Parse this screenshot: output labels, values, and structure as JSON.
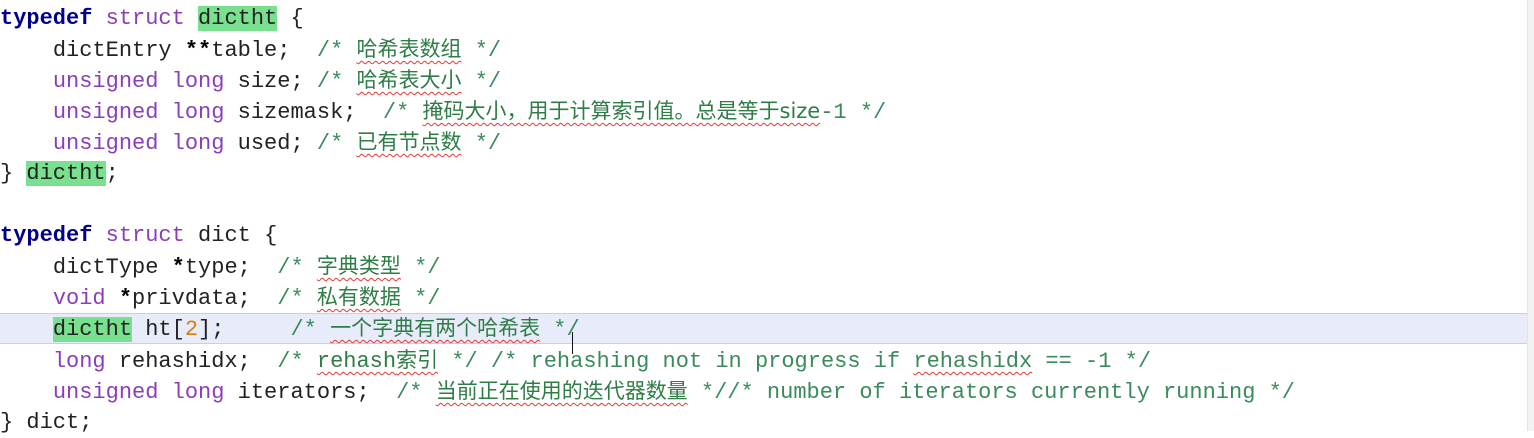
{
  "code": {
    "line1": {
      "kw": "typedef",
      "struct_kw": "struct",
      "name": "dictht",
      "brace": "{"
    },
    "line2": {
      "type": "dictEntry",
      "ptr": "**",
      "field": "table;",
      "cmt_open": "/*",
      "cmt_text": "哈希表数组",
      "cmt_close": "*/"
    },
    "line3": {
      "type": "unsigned long",
      "field": "size;",
      "cmt_open": "/*",
      "cmt_text": "哈希表大小",
      "cmt_close": "*/"
    },
    "line4": {
      "type": "unsigned long",
      "field": "sizemask;",
      "cmt_open": "/*",
      "cmt_text": "掩码大小，用于计算索引值。总是等于size",
      "cmt_tail": "-1",
      "cmt_close": "*/"
    },
    "line5": {
      "type": "unsigned long",
      "field": "used;",
      "cmt_open": "/*",
      "cmt_text": "已有节点数",
      "cmt_close": "*/"
    },
    "line6": {
      "close_brace": "}",
      "name": "dictht",
      "semi": ";"
    },
    "line8": {
      "kw": "typedef",
      "struct_kw": "struct",
      "name": "dict",
      "brace": "{"
    },
    "line9": {
      "type": "dictType",
      "ptr": "*",
      "field": "type;",
      "cmt_open": "/*",
      "cmt_text": "字典类型",
      "cmt_close": "*/"
    },
    "line10": {
      "type": "void",
      "ptr": "*",
      "field": "privdata;",
      "cmt_open": "/*",
      "cmt_text": "私有数据",
      "cmt_close": "*/"
    },
    "line11": {
      "type": "dictht",
      "field_a": "ht[",
      "num": "2",
      "field_b": "];",
      "cmt_open": "/*",
      "cmt_text": "一个字典有两个哈希表",
      "cmt_close": "*/"
    },
    "line12": {
      "type": "long",
      "field": "rehashidx;",
      "cmt_open": "/*",
      "cmt_text_a": "rehash",
      "cmt_text_b": "索引",
      "cmt_mid": "*/ /* rehashing not in progress if",
      "cmt_word": "rehashidx",
      "cmt_tail": "== -1 */"
    },
    "line13": {
      "type": "unsigned long",
      "field": "iterators;",
      "cmt_open": "/*",
      "cmt_text": "当前正在使用的迭代器数量",
      "cmt_close": "*//* number of iterators currently running */"
    },
    "line14": {
      "close_brace": "}",
      "name": "dict;"
    }
  },
  "colors": {
    "keyword": "#00008b",
    "type": "#8a3fb8",
    "comment": "#3a8a5c",
    "number": "#e07a0a",
    "highlight": "#79e08f",
    "current_line": "#e8ebfa"
  }
}
